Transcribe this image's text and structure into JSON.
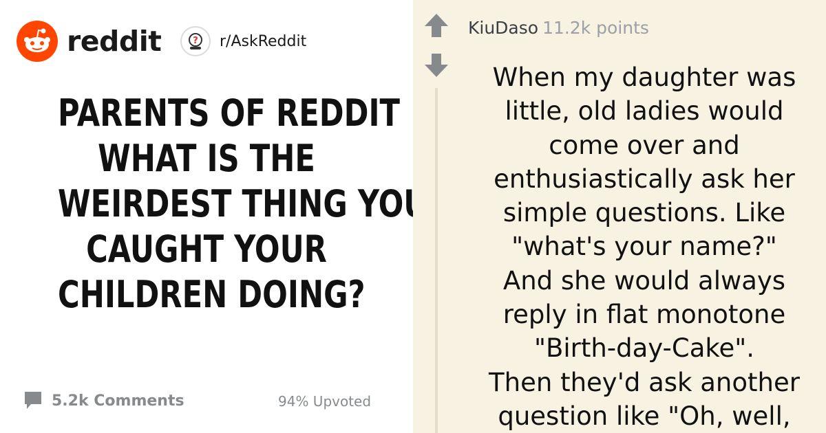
{
  "header": {
    "brand": "reddit",
    "subreddit": "r/AskReddit",
    "logo_icon": "reddit-snoo-icon",
    "subreddit_icon": "askreddit-question-icon"
  },
  "question": {
    "lines": [
      "PARENTS OF REDDIT",
      "WHAT IS THE",
      "WEIRDEST THING YOU",
      "CAUGHT YOUR",
      "CHILDREN DOING?"
    ]
  },
  "footer": {
    "comments": "5.2k Comments",
    "upvoted": "94% Upvoted",
    "comment_icon": "comment-bubble-icon"
  },
  "comment": {
    "author": "KiuDaso",
    "points": "11.2k points",
    "lines": [
      "When my daughter was",
      "little, old ladies would",
      "come over and",
      "enthusiastically ask her",
      "simple questions. Like",
      "\"what's your name?\"",
      "And she would always",
      "reply in flat monotone",
      "\"Birth-day-Cake\".",
      "Then they'd ask another",
      "question like \"Oh, well,"
    ]
  },
  "colors": {
    "reddit_orange": "#ff4500",
    "comment_background": "#f7f2e1",
    "muted_gray": "#878a8c"
  }
}
